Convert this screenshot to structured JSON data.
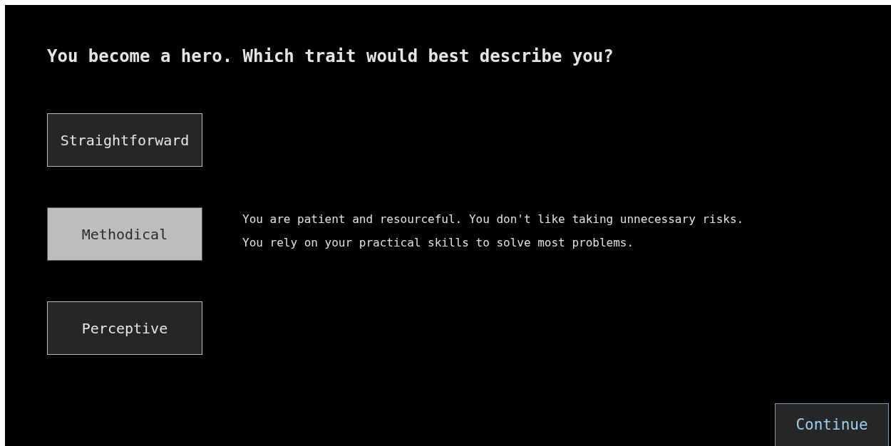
{
  "question": "You become a hero. Which trait would best describe you?",
  "options": [
    {
      "label": "Straightforward",
      "selected": false
    },
    {
      "label": "Methodical",
      "selected": true
    },
    {
      "label": "Perceptive",
      "selected": false
    }
  ],
  "description": [
    "You are patient and resourceful. You don't like taking unnecessary risks.",
    "You rely on your practical skills to solve most problems."
  ],
  "continue_button": "Continue"
}
